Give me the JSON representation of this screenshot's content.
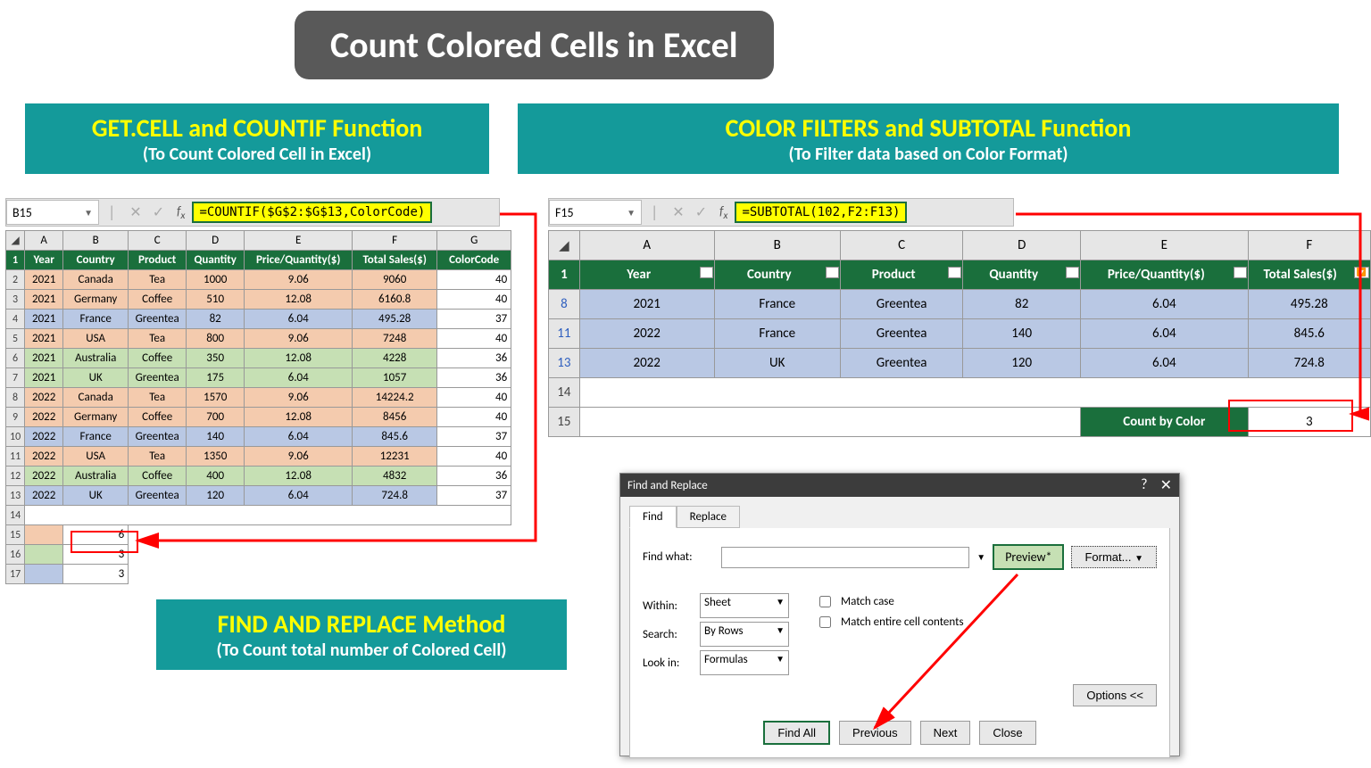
{
  "title": "Count Colored Cells in Excel",
  "banners": {
    "left": {
      "title": "GET.CELL and COUNTIF Function",
      "sub": "(To Count Colored Cell in Excel)"
    },
    "right": {
      "title": "COLOR FILTERS and SUBTOTAL Function",
      "sub": "(To Filter data based on Color Format)"
    },
    "bottom": {
      "title": "FIND AND REPLACE Method",
      "sub": "(To Count total number of Colored Cell)"
    }
  },
  "left_panel": {
    "cell_ref": "B15",
    "formula": "=COUNTIF($G$2:$G$13,ColorCode)",
    "cols": [
      "A",
      "B",
      "C",
      "D",
      "E",
      "F",
      "G"
    ],
    "headers": [
      "Year",
      "Country",
      "Product",
      "Quantity",
      "Price/Quantity($)",
      "Total Sales($)",
      "ColorCode"
    ],
    "rows": [
      {
        "n": "2",
        "c": "or",
        "d": [
          "2021",
          "Canada",
          "Tea",
          "1000",
          "9.06",
          "9060"
        ],
        "code": "40"
      },
      {
        "n": "3",
        "c": "or",
        "d": [
          "2021",
          "Germany",
          "Coffee",
          "510",
          "12.08",
          "6160.8"
        ],
        "code": "40"
      },
      {
        "n": "4",
        "c": "bl",
        "d": [
          "2021",
          "France",
          "Greentea",
          "82",
          "6.04",
          "495.28"
        ],
        "code": "37"
      },
      {
        "n": "5",
        "c": "or",
        "d": [
          "2021",
          "USA",
          "Tea",
          "800",
          "9.06",
          "7248"
        ],
        "code": "40"
      },
      {
        "n": "6",
        "c": "gr",
        "d": [
          "2021",
          "Australia",
          "Coffee",
          "350",
          "12.08",
          "4228"
        ],
        "code": "36"
      },
      {
        "n": "7",
        "c": "gr",
        "d": [
          "2021",
          "UK",
          "Greentea",
          "175",
          "6.04",
          "1057"
        ],
        "code": "36"
      },
      {
        "n": "8",
        "c": "or",
        "d": [
          "2022",
          "Canada",
          "Tea",
          "1570",
          "9.06",
          "14224.2"
        ],
        "code": "40"
      },
      {
        "n": "9",
        "c": "or",
        "d": [
          "2022",
          "Germany",
          "Coffee",
          "700",
          "12.08",
          "8456"
        ],
        "code": "40"
      },
      {
        "n": "10",
        "c": "bl",
        "d": [
          "2022",
          "France",
          "Greentea",
          "140",
          "6.04",
          "845.6"
        ],
        "code": "37"
      },
      {
        "n": "11",
        "c": "or",
        "d": [
          "2022",
          "USA",
          "Tea",
          "1350",
          "9.06",
          "12231"
        ],
        "code": "40"
      },
      {
        "n": "12",
        "c": "gr",
        "d": [
          "2022",
          "Australia",
          "Coffee",
          "400",
          "12.08",
          "4832"
        ],
        "code": "36"
      },
      {
        "n": "13",
        "c": "bl",
        "d": [
          "2022",
          "UK",
          "Greentea",
          "120",
          "6.04",
          "724.8"
        ],
        "code": "37"
      }
    ],
    "results": [
      {
        "n": "15",
        "fill": "#f4cbae",
        "val": "6"
      },
      {
        "n": "16",
        "fill": "#c6e0b4",
        "val": "3"
      },
      {
        "n": "17",
        "fill": "#b9c8e4",
        "val": "3"
      }
    ]
  },
  "right_panel": {
    "cell_ref": "F15",
    "formula": "=SUBTOTAL(102,F2:F13)",
    "cols": [
      "A",
      "B",
      "C",
      "D",
      "E",
      "F"
    ],
    "headers": [
      "Year",
      "Country",
      "Product",
      "Quantity",
      "Price/Quantity($)",
      "Total Sales($)"
    ],
    "rows": [
      {
        "n": "8",
        "d": [
          "2021",
          "France",
          "Greentea",
          "82",
          "6.04",
          "495.28"
        ]
      },
      {
        "n": "11",
        "d": [
          "2022",
          "France",
          "Greentea",
          "140",
          "6.04",
          "845.6"
        ]
      },
      {
        "n": "13",
        "d": [
          "2022",
          "UK",
          "Greentea",
          "120",
          "6.04",
          "724.8"
        ]
      }
    ],
    "count_label": "Count by Color",
    "count_value": "3"
  },
  "dialog": {
    "title": "Find and Replace",
    "tabs": [
      "Find",
      "Replace"
    ],
    "find_what_label": "Find what:",
    "preview": "Preview*",
    "format_btn": "Format...",
    "within_label": "Within:",
    "within_value": "Sheet",
    "search_label": "Search:",
    "search_value": "By Rows",
    "lookin_label": "Look in:",
    "lookin_value": "Formulas",
    "match_case": "Match case",
    "match_entire": "Match entire cell contents",
    "options": "Options <<",
    "buttons": [
      "Find All",
      "Previous",
      "Next",
      "Close"
    ]
  }
}
